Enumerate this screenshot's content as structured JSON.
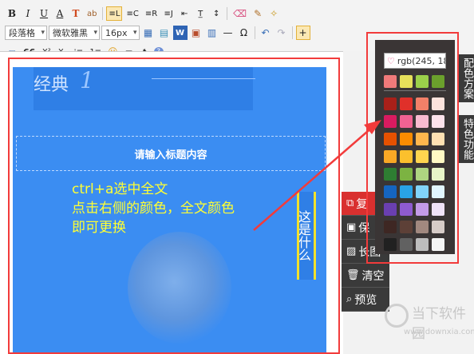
{
  "toolbar": {
    "row1": [
      "B",
      "I",
      "U",
      "A",
      "T",
      "ab",
      "≡L",
      "≡C",
      "≡R",
      "≡J",
      "⇤",
      "T̲",
      "↕"
    ],
    "row2": {
      "paragraph_select": "段落格",
      "font_select": "微软雅黑",
      "size_select": "16px",
      "icons": [
        "table-icon",
        "image-icon",
        "word-icon",
        "media-icon",
        "hr-icon",
        "omega-icon",
        "undo-icon",
        "redo-icon",
        "plus-icon"
      ],
      "omega": "Ω"
    },
    "row3": [
      "66",
      "X²",
      "X₂",
      "⁝≡",
      "1≡",
      "☺",
      "▭",
      "♞",
      "?"
    ]
  },
  "editor": {
    "header_text": "经典",
    "header_number": "1",
    "title_placeholder": "请输入标题内容",
    "hint_lines": [
      "ctrl+a选中全文",
      "点击右侧的颜色，全文颜色",
      "即可更换"
    ],
    "vertical_label": "这是什么"
  },
  "side_menu": [
    {
      "icon": "copy-icon",
      "glyph": "⧉",
      "label": "复"
    },
    {
      "icon": "save-icon",
      "glyph": "▣",
      "label": "保"
    },
    {
      "icon": "long-image-icon",
      "glyph": "▨",
      "label": "长图"
    },
    {
      "icon": "trash-icon",
      "glyph": "🗑",
      "label": "清空"
    },
    {
      "icon": "search-icon",
      "glyph": "⌕",
      "label": "预览"
    }
  ],
  "palette": {
    "input_value": "rgb(245, 18",
    "row_top": [
      "#f07a7a",
      "#e6e05a",
      "#9cd04a",
      "#6ba02c"
    ],
    "rows": [
      [
        "#a82019",
        "#e0302a",
        "#f28068",
        "#fde3dc"
      ],
      [
        "#d81b60",
        "#f06292",
        "#f8bbd0",
        "#fde2ea"
      ],
      [
        "#e65100",
        "#fb8c00",
        "#ffb74d",
        "#ffe0b2"
      ],
      [
        "#f9a825",
        "#fbc02d",
        "#ffd54f",
        "#fff9c4"
      ],
      [
        "#2e7d32",
        "#7cb342",
        "#aed581",
        "#e8f5c8"
      ],
      [
        "#1565c0",
        "#29a3e6",
        "#81d4fa",
        "#e1f5fe"
      ],
      [
        "#6a3fb0",
        "#8e5bd0",
        "#c39be8",
        "#f0e3f8"
      ],
      [
        "#3e2723",
        "#5d4037",
        "#a1887f",
        "#d7ccc8"
      ],
      [
        "#212121",
        "#616161",
        "#bdbdbd",
        "#f5f5f5"
      ]
    ]
  },
  "vertical_tabs": {
    "tab1": "配色方案",
    "tab2": "特色功能"
  },
  "watermark": {
    "name": "当下软件园",
    "url": "www.downxia.com"
  },
  "colors": {
    "accent_red": "#f23b3b",
    "editor_blue": "#3b8df2",
    "hint_yellow": "#ffff33"
  }
}
